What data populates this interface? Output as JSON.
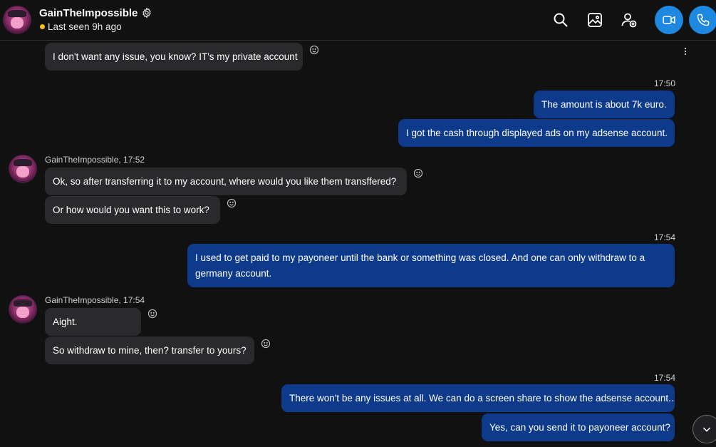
{
  "header": {
    "contact_name": "GainTheImpossible",
    "presence": "Last seen 9h ago",
    "presence_color": "#f7c21a",
    "icons": [
      "search-icon",
      "gallery-icon",
      "add-person-icon",
      "video-call-icon",
      "phone-icon"
    ],
    "accent_color": "#1e87df"
  },
  "messages": [
    {
      "direction": "in",
      "text": "I don't want any issue, you know? IT's my private account"
    },
    {
      "direction": "out",
      "timestamp": "17:50",
      "text": "The amount is about 7k euro."
    },
    {
      "direction": "out",
      "text": "I got the cash through displayed ads on my adsense account."
    },
    {
      "direction": "in",
      "sender": "GainTheImpossible, 17:52",
      "text": "Ok, so after transferring it to my account, where would you like them transffered?"
    },
    {
      "direction": "in",
      "text": "Or how would you want this to work?"
    },
    {
      "direction": "out",
      "timestamp": "17:54",
      "text": "I used to get paid to my payoneer until the bank or something was closed. And one can only withdraw to a germany account."
    },
    {
      "direction": "in",
      "sender": "GainTheImpossible, 17:54",
      "text": "Aight."
    },
    {
      "direction": "in",
      "text": "So withdraw to mine, then? transfer to yours?"
    },
    {
      "direction": "out",
      "timestamp": "17:54",
      "text": "There won't be any issues at all. We can do a screen share to show the adsense account..."
    },
    {
      "direction": "out",
      "text": "Yes, can you send it to payoneer account?"
    }
  ],
  "colors": {
    "incoming_bubble": "#2a2a2c",
    "outgoing_bubble": "#0e3a8b",
    "background": "#111112"
  }
}
